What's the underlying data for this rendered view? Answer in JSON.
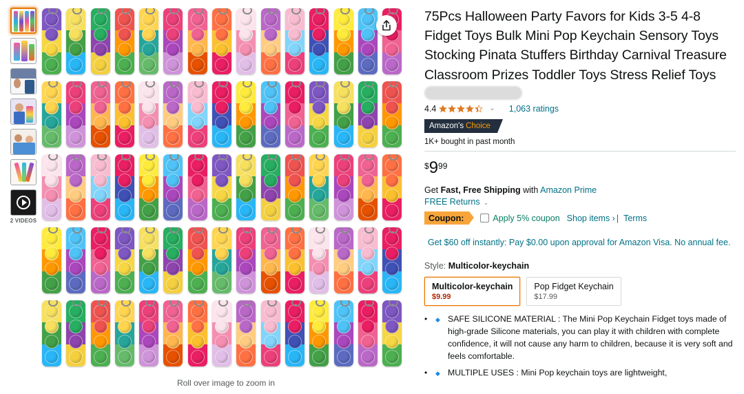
{
  "thumbnails": [
    {
      "name": "thumb-1-pop-grid",
      "active": true
    },
    {
      "name": "thumb-2-packaging"
    },
    {
      "name": "thumb-3-classroom"
    },
    {
      "name": "thumb-4-kids-playing"
    },
    {
      "name": "thumb-5-family"
    },
    {
      "name": "thumb-6-hand-detail"
    },
    {
      "name": "thumb-7-video"
    }
  ],
  "videos_label": "2 VIDEOS",
  "zoom_hint": "Roll over image to zoom in",
  "product": {
    "title": "75Pcs Halloween Party Favors for Kids 3-5 4-8 Fidget Toys Bulk Mini Pop Keychain Sensory Toys Stocking Pinata Stuffers Birthday Carnival Treasure Classroom Prizes Toddler Toys Stress Relief Toys",
    "rating_value": "4.4",
    "rating_stars": 4.4,
    "ratings_count": "1,063 ratings",
    "badge_prefix": "Amazon's",
    "badge_suffix": "Choice",
    "bought_text": "1K+ bought in past month",
    "price_symbol": "$",
    "price_whole": "9",
    "price_fraction": "99",
    "shipping_prefix": "Get",
    "shipping_bold": "Fast, Free Shipping",
    "shipping_with": "with",
    "shipping_link": "Amazon Prime",
    "returns": "FREE Returns",
    "coupon_tag": "Coupon:",
    "coupon_text": "Apply 5% coupon",
    "shop_items": "Shop items ›",
    "separator": "|",
    "terms": "Terms",
    "visa_offer": "Get $60 off instantly: Pay $0.00 upon approval for Amazon Visa. No annual fee.",
    "style_label": "Style:",
    "style_value": "Multicolor-keychain",
    "options": [
      {
        "name": "Multicolor-keychain",
        "price": "$9.99",
        "selected": true
      },
      {
        "name": "Pop Fidget Keychain",
        "price": "$17.99",
        "selected": false
      }
    ],
    "bullets": [
      "SAFE SILICONE MATERIAL : The Mini Pop Keychain Fidget toys made of high-grade Silicone materials, you can play it with children with complete confidence, it will not cause any harm to children, because it is very soft and feels comfortable.",
      "MULTIPLE USES : Mini Pop keychain toys are lightweight,"
    ]
  },
  "colors": {
    "accent_orange": "#e77600",
    "link_teal": "#007185",
    "price_red": "#b12704",
    "badge_navy": "#232f3e",
    "coupon_orange": "#f7a53a",
    "star_orange": "#de7921"
  }
}
